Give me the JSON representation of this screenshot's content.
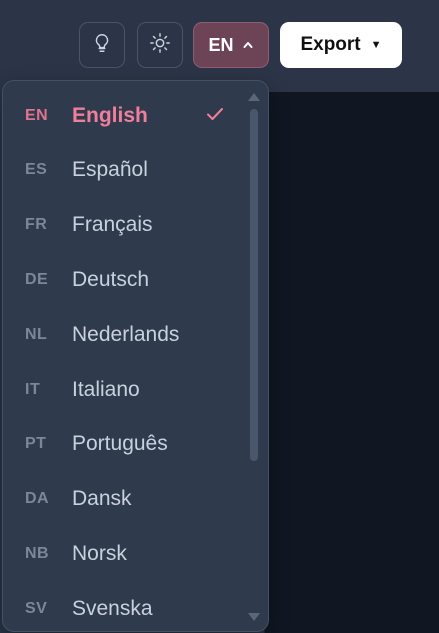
{
  "header": {
    "language_button_code": "EN",
    "export_label": "Export"
  },
  "icons": {
    "bulb": "lightbulb-icon",
    "theme": "sun-icon",
    "chevron": "chevron-up-icon",
    "export_caret": "caret-down-icon",
    "check": "checkmark-icon"
  },
  "colors": {
    "accent": "#ef7f9b",
    "language_button_bg": "#6d4456",
    "dropdown_bg": "#2f3a4d",
    "editor_bg": "#101722"
  },
  "languages": [
    {
      "code": "EN",
      "name": "English",
      "selected": true
    },
    {
      "code": "ES",
      "name": "Español",
      "selected": false
    },
    {
      "code": "FR",
      "name": "Français",
      "selected": false
    },
    {
      "code": "DE",
      "name": "Deutsch",
      "selected": false
    },
    {
      "code": "NL",
      "name": "Nederlands",
      "selected": false
    },
    {
      "code": "IT",
      "name": "Italiano",
      "selected": false
    },
    {
      "code": "PT",
      "name": "Português",
      "selected": false
    },
    {
      "code": "DA",
      "name": "Dansk",
      "selected": false
    },
    {
      "code": "NB",
      "name": "Norsk",
      "selected": false
    },
    {
      "code": "SV",
      "name": "Svenska",
      "selected": false
    }
  ]
}
